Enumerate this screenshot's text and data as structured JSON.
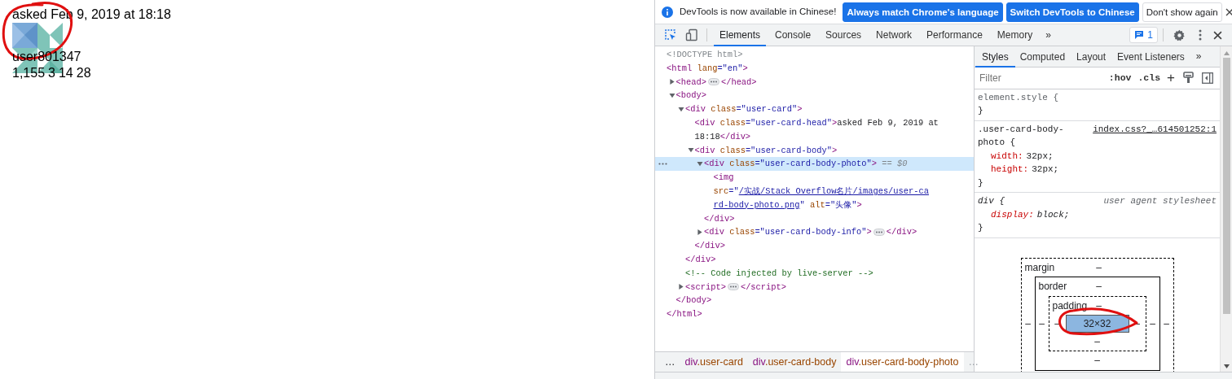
{
  "page": {
    "head": "asked Feb 9, 2019 at 18:18",
    "avatar": {
      "kind": "picture"
    },
    "user": "user801347",
    "stats": [
      "1,155",
      "3",
      "14",
      "28"
    ]
  },
  "devtools": {
    "infobar": {
      "message": "DevTools is now available in Chinese!",
      "buttons": [
        {
          "label": "Always match Chrome's language",
          "kind": "primary"
        },
        {
          "label": "Switch DevTools to Chinese",
          "kind": "primary"
        },
        {
          "label": "Don't show again",
          "kind": "plain"
        }
      ]
    },
    "tabs": [
      {
        "label": "Elements",
        "selected": true
      },
      {
        "label": "Console",
        "selected": false
      },
      {
        "label": "Sources",
        "selected": false
      },
      {
        "label": "Network",
        "selected": false
      },
      {
        "label": "Performance",
        "selected": false
      },
      {
        "label": "Memory",
        "selected": false
      }
    ],
    "more_tabs": "»",
    "issues_count": "1",
    "dom": [
      {
        "selected": false,
        "open": [
          {
            "kind": "doctype",
            "text": "<!DOCTYPE html>"
          }
        ]
      },
      {
        "selected": false,
        "open": [
          {
            "kind": "tag",
            "text": "<html"
          },
          {
            "kind": "attr",
            "text": " lang"
          },
          {
            "kind": "value",
            "text": "=\"en\""
          },
          {
            "kind": "tag",
            "text": ">"
          }
        ],
        "close": [
          {
            "kind": "tag",
            "text": "</html>"
          }
        ],
        "children": [
          {
            "selected": false,
            "expanded": false,
            "open": [
              {
                "kind": "tag",
                "text": "<head>"
              }
            ],
            "close": [
              {
                "kind": "tag",
                "text": "</head>"
              }
            ]
          },
          {
            "selected": false,
            "expanded": true,
            "open": [
              {
                "kind": "tag",
                "text": "<body>"
              }
            ],
            "close": [
              {
                "kind": "tag",
                "text": "</body>"
              }
            ],
            "children": [
              {
                "selected": false,
                "expanded": true,
                "open": [
                  {
                    "kind": "tag",
                    "text": "<div"
                  },
                  {
                    "kind": "attr",
                    "text": " class"
                  },
                  {
                    "kind": "value",
                    "text": "=\"user-card\""
                  },
                  {
                    "kind": "tag",
                    "text": ">"
                  }
                ],
                "close": [
                  {
                    "kind": "tag",
                    "text": "</div>"
                  }
                ],
                "children": [
                  {
                    "selected": false,
                    "open": [
                      {
                        "kind": "tag",
                        "text": "<div"
                      },
                      {
                        "kind": "attr",
                        "text": " class"
                      },
                      {
                        "kind": "value",
                        "text": "=\"user-card-head\""
                      },
                      {
                        "kind": "tag",
                        "text": ">"
                      },
                      {
                        "kind": "text",
                        "text": "asked Feb 9, 2019 at 18:18"
                      },
                      {
                        "kind": "tag",
                        "text": "</div>"
                      }
                    ]
                  },
                  {
                    "selected": false,
                    "expanded": true,
                    "open": [
                      {
                        "kind": "tag",
                        "text": "<div"
                      },
                      {
                        "kind": "attr",
                        "text": " class"
                      },
                      {
                        "kind": "value",
                        "text": "=\"user-card-body\""
                      },
                      {
                        "kind": "tag",
                        "text": ">"
                      }
                    ],
                    "close": [
                      {
                        "kind": "tag",
                        "text": "</div>"
                      }
                    ],
                    "children": [
                      {
                        "selected": true,
                        "expanded": true,
                        "open": [
                          {
                            "kind": "tag",
                            "text": "<div"
                          },
                          {
                            "kind": "attr",
                            "text": " class"
                          },
                          {
                            "kind": "value",
                            "text": "=\"user-card-body-photo\""
                          },
                          {
                            "kind": "tag",
                            "text": ">"
                          },
                          {
                            "kind": "marker",
                            "text": " == $0"
                          }
                        ],
                        "close": [
                          {
                            "kind": "tag",
                            "text": "</div>"
                          }
                        ],
                        "children": [
                          {
                            "selected": false,
                            "open": [
                              {
                                "kind": "tag",
                                "text": "<img"
                              },
                              {
                                "kind": "attr",
                                "text": " src"
                              },
                              {
                                "kind": "value",
                                "text": "=\""
                              },
                              {
                                "kind": "link",
                                "text": "/实战/Stack Overflow名片/images/user-ca"
                              },
                              {
                                "kind": "link",
                                "text": "rd-body-photo.png"
                              },
                              {
                                "kind": "value",
                                "text": "\""
                              },
                              {
                                "kind": "attr",
                                "text": " alt"
                              },
                              {
                                "kind": "value",
                                "text": "=\"头像\""
                              },
                              {
                                "kind": "tag",
                                "text": ">"
                              }
                            ]
                          }
                        ]
                      },
                      {
                        "selected": false,
                        "expanded": false,
                        "open": [
                          {
                            "kind": "tag",
                            "text": "<div"
                          },
                          {
                            "kind": "attr",
                            "text": " class"
                          },
                          {
                            "kind": "value",
                            "text": "=\"user-card-body-info\""
                          },
                          {
                            "kind": "tag",
                            "text": ">"
                          }
                        ],
                        "close": [
                          {
                            "kind": "tag",
                            "text": "</div>"
                          }
                        ]
                      }
                    ]
                  }
                ]
              },
              {
                "selected": false,
                "open": [
                  {
                    "kind": "comment",
                    "text": "<!-- Code injected by live-server -->"
                  }
                ]
              },
              {
                "selected": false,
                "expanded": false,
                "open": [
                  {
                    "kind": "tag",
                    "text": "<script>"
                  }
                ],
                "close": [
                  {
                    "kind": "tag",
                    "text": "</script>"
                  }
                ]
              }
            ]
          }
        ]
      }
    ],
    "breadcrumbs": [
      {
        "tag": "div",
        "cls": ".user-card",
        "selected": false
      },
      {
        "tag": "div",
        "cls": ".user-card-body",
        "selected": false
      },
      {
        "tag": "div",
        "cls": ".user-card-body-photo",
        "selected": true
      }
    ],
    "breadcrumb_more": "…",
    "side_tabs": [
      {
        "label": "Styles",
        "selected": true
      },
      {
        "label": "Computed",
        "selected": false
      },
      {
        "label": "Layout",
        "selected": false
      },
      {
        "label": "Event Listeners",
        "selected": false
      }
    ],
    "side_more": "»",
    "filter": {
      "placeholder": "Filter"
    },
    "hov": ":hov",
    "cls": ".cls",
    "add": "+",
    "rules": [
      {
        "selector": "element.style {",
        "kind": "inline",
        "close": "}"
      },
      {
        "selector": ".user-card-body-photo {",
        "source": "index.css?_…614501252:1",
        "kind": "author",
        "properties": [
          {
            "name": "width:",
            "value": "32px;"
          },
          {
            "name": "height:",
            "value": "32px;"
          }
        ],
        "close": "}"
      },
      {
        "selector": "div {",
        "source": "user agent stylesheet",
        "kind": "user-agent",
        "properties": [
          {
            "name": "display:",
            "value": "block;"
          }
        ],
        "close": "}"
      }
    ],
    "box_model": {
      "margin": {
        "label": "margin",
        "top": "–",
        "left": "–",
        "right": "–"
      },
      "border": {
        "label": "border",
        "top": "–",
        "left": "–",
        "right": "–",
        "bottom": "–"
      },
      "padding": {
        "label": "padding",
        "top": "–",
        "left": "–",
        "right": "–",
        "bottom": "–"
      },
      "content": "32×32"
    }
  }
}
